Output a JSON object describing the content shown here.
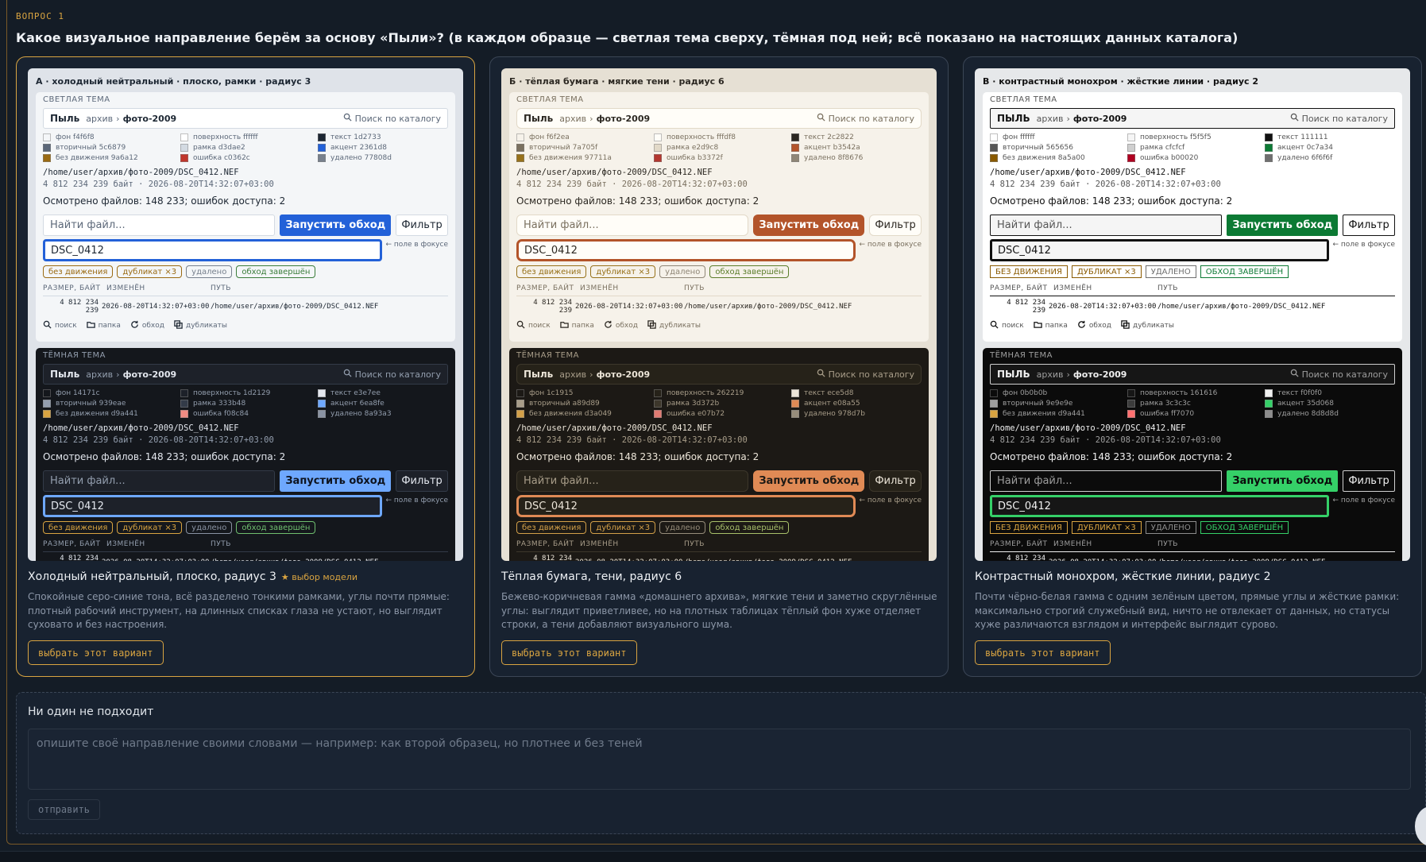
{
  "question": {
    "label": "ВОПРОС 1",
    "title": "Какое визуальное направление берём за основу «Пыли»? (в каждом образце — светлая тема сверху, тёмная под ней; всё показано на настоящих данных каталога)"
  },
  "common": {
    "brand_lower": "Пыль",
    "brand_upper": "ПЫЛЬ",
    "crumb": "архив",
    "crumb_sep": "›",
    "crumb_current": "фото-2009",
    "search_label": "Поиск по каталогу",
    "light_label": "СВЕТЛАЯ ТЕМА",
    "dark_label": "ТЁМНАЯ ТЕМА",
    "path": "/home/user/архив/фото-2009/DSC_0412.NEF",
    "meta": "4 812 234 239 байт · 2026-08-20T14:32:07+03:00",
    "stats": "Осмотрено файлов: 148 233; ошибок доступа: 2",
    "find_placeholder": "Найти файл...",
    "run_label": "Запустить обход",
    "filter_label": "Фильтр",
    "focus_value": "DSC_0412",
    "focus_note": "← поле в фокусе",
    "tags": [
      "без движения",
      "дубликат ×3",
      "удалено",
      "обход завершён"
    ],
    "tags_upper": [
      "БЕЗ ДВИЖЕНИЯ",
      "ДУБЛИКАТ ×3",
      "УДАЛЕНО",
      "ОБХОД ЗАВЕРШЁН"
    ],
    "table_headers": [
      "РАЗМЕР, БАЙТ",
      "ИЗМЕНЁН",
      "ПУТЬ"
    ],
    "row_size": [
      "4 812",
      "234",
      "239"
    ],
    "row_date": "2026-08-20T14:32:07+03:00",
    "row_path": "/home/user/архив/фото-2009/DSC_0412.NEF",
    "icons": [
      "поиск",
      "папка",
      "обход",
      "дубликаты"
    ]
  },
  "options": [
    {
      "preview_title": "А · холодный нейтральный · плоско, рамки · радиус 3",
      "title": "Холодный нейтральный, плоско, радиус 3",
      "model_badge": "★ выбор модели",
      "desc": "Спокойные серо-синие тона, всё разделено тонкими рамками, углы почти прямые: плотный рабочий инструмент, на длинных списках глаза не устают, но выглядит суховато и без настроения.",
      "choose_label": "выбрать этот вариант",
      "light": {
        "swatches": [
          {
            "label": "фон f4f6f8",
            "color": "#f4f6f8"
          },
          {
            "label": "поверхность ffffff",
            "color": "#ffffff"
          },
          {
            "label": "текст 1d2733",
            "color": "#1d2733"
          },
          {
            "label": "вторичный 5c6879",
            "color": "#5c6879"
          },
          {
            "label": "рамка d3dae2",
            "color": "#d3dae2"
          },
          {
            "label": "акцент 2361d8",
            "color": "#2361d8"
          },
          {
            "label": "без движения 9a6a12",
            "color": "#9a6a12"
          },
          {
            "label": "ошибка c0362c",
            "color": "#c0362c"
          },
          {
            "label": "удалено 77808d",
            "color": "#77808d"
          }
        ]
      },
      "dark": {
        "swatches": [
          {
            "label": "фон 14171c",
            "color": "#14171c"
          },
          {
            "label": "поверхность 1d2129",
            "color": "#1d2129"
          },
          {
            "label": "текст e3e7ee",
            "color": "#e3e7ee"
          },
          {
            "label": "вторичный 939eae",
            "color": "#939eae"
          },
          {
            "label": "рамка 333b48",
            "color": "#333b48"
          },
          {
            "label": "акцент 6ea8fe",
            "color": "#6ea8fe"
          },
          {
            "label": "без движения d9a441",
            "color": "#d9a441"
          },
          {
            "label": "ошибка f08c84",
            "color": "#f08c84"
          },
          {
            "label": "удалено 8a93a3",
            "color": "#8a93a3"
          }
        ]
      }
    },
    {
      "preview_title": "Б · тёплая бумага · мягкие тени · радиус 6",
      "title": "Тёплая бумага, тени, радиус 6",
      "desc": "Бежево-коричневая гамма «домашнего архива», мягкие тени и заметно скруглённые углы: выглядит приветливее, но на плотных таблицах тёплый фон хуже отделяет строки, а тени добавляют визуального шума.",
      "choose_label": "выбрать этот вариант",
      "light": {
        "swatches": [
          {
            "label": "фон f6f2ea",
            "color": "#f6f2ea"
          },
          {
            "label": "поверхность fffdf8",
            "color": "#fffdf8"
          },
          {
            "label": "текст 2c2822",
            "color": "#2c2822"
          },
          {
            "label": "вторичный 7a705f",
            "color": "#7a705f"
          },
          {
            "label": "рамка e2d9c8",
            "color": "#e2d9c8"
          },
          {
            "label": "акцент b3542a",
            "color": "#b3542a"
          },
          {
            "label": "без движения 97711a",
            "color": "#97711a"
          },
          {
            "label": "ошибка b3372f",
            "color": "#b3372f"
          },
          {
            "label": "удалено 8f8676",
            "color": "#8f8676"
          }
        ]
      },
      "dark": {
        "swatches": [
          {
            "label": "фон 1c1915",
            "color": "#1c1915"
          },
          {
            "label": "поверхность 262219",
            "color": "#262219"
          },
          {
            "label": "текст ece5d8",
            "color": "#ece5d8"
          },
          {
            "label": "вторичный a89d89",
            "color": "#a89d89"
          },
          {
            "label": "рамка 3d372b",
            "color": "#3d372b"
          },
          {
            "label": "акцент e08a55",
            "color": "#e08a55"
          },
          {
            "label": "без движения d3a049",
            "color": "#d3a049"
          },
          {
            "label": "ошибка e07b72",
            "color": "#e07b72"
          },
          {
            "label": "удалено 978d7b",
            "color": "#978d7b"
          }
        ]
      }
    },
    {
      "preview_title": "В · контрастный монохром · жёсткие линии · радиус 2",
      "title": "Контрастный монохром, жёсткие линии, радиус 2",
      "desc": "Почти чёрно-белая гамма с одним зелёным цветом, прямые углы и жёсткие рамки: максимально строгий служебный вид, ничто не отвлекает от данных, но статусы хуже различаются взглядом и интерфейс выглядит сурово.",
      "choose_label": "выбрать этот вариант",
      "light": {
        "swatches": [
          {
            "label": "фон ffffff",
            "color": "#ffffff"
          },
          {
            "label": "поверхность f5f5f5",
            "color": "#f5f5f5"
          },
          {
            "label": "текст 111111",
            "color": "#111111"
          },
          {
            "label": "вторичный 565656",
            "color": "#565656"
          },
          {
            "label": "рамка cfcfcf",
            "color": "#cfcfcf"
          },
          {
            "label": "акцент 0c7a34",
            "color": "#0c7a34"
          },
          {
            "label": "без движения 8a5a00",
            "color": "#8a5a00"
          },
          {
            "label": "ошибка b00020",
            "color": "#b00020"
          },
          {
            "label": "удалено 6f6f6f",
            "color": "#6f6f6f"
          }
        ]
      },
      "dark": {
        "swatches": [
          {
            "label": "фон 0b0b0b",
            "color": "#0b0b0b"
          },
          {
            "label": "поверхность 161616",
            "color": "#161616"
          },
          {
            "label": "текст f0f0f0",
            "color": "#f0f0f0"
          },
          {
            "label": "вторичный 9e9e9e",
            "color": "#9e9e9e"
          },
          {
            "label": "рамка 3c3c3c",
            "color": "#3c3c3c"
          },
          {
            "label": "акцент 35d068",
            "color": "#35d068"
          },
          {
            "label": "без движения d9a441",
            "color": "#d9a441"
          },
          {
            "label": "ошибка ff7070",
            "color": "#ff7070"
          },
          {
            "label": "удалено 8d8d8d",
            "color": "#8d8d8d"
          }
        ]
      }
    }
  ],
  "none_option": {
    "title": "Ни один не подходит",
    "placeholder": "опишите своё направление своими словами — например: как второй образец, но плотнее и без теней",
    "send_label": "отправить"
  }
}
